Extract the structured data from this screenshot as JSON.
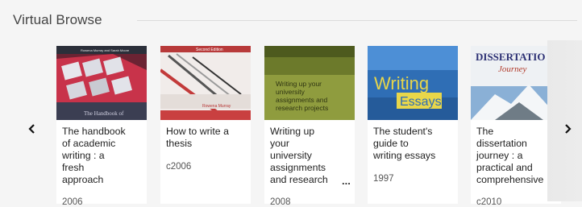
{
  "header": {
    "title": "Virtual Browse"
  },
  "nav": {
    "prev_icon": "chevron-left-icon",
    "next_icon": "chevron-right-icon"
  },
  "books": [
    {
      "title": "The handbook\nof academic\nwriting : a\nfresh\napproach",
      "year": "2006",
      "cover_text": [
        "Rowena Murray and Sarah Moore",
        "The Handbook of"
      ]
    },
    {
      "title": "How to write a\nthesis",
      "year": "c2006",
      "cover_text": [
        "Second Edition",
        "Rowena Murray"
      ]
    },
    {
      "title": "Writing up\nyour\nuniversity\nassignments\nand research",
      "year": "2008",
      "cover_text": [
        "Writing up your",
        "university",
        "assignments and",
        "research projects"
      ]
    },
    {
      "title": "The student's\nguide to\nwriting essays",
      "year": "1997",
      "cover_text": [
        "Writing",
        "Essays"
      ]
    },
    {
      "title": "The\ndissertation\njourney : a\npractical and\ncomprehensive",
      "year": "c2010",
      "cover_text": [
        "DISSERTATIO",
        "Journey"
      ]
    }
  ],
  "colors": {
    "background": "#f5f5f5",
    "card": "#ffffff",
    "rule": "#dcdcdc"
  }
}
